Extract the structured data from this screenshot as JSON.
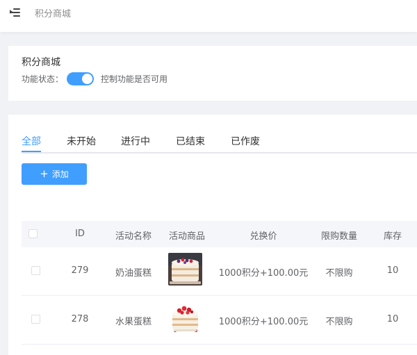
{
  "header": {
    "menu_icon": "hamburger-fold-icon",
    "breadcrumb": "积分商城"
  },
  "settings": {
    "title": "积分商城",
    "status_label": "功能状态：",
    "switch_on": true,
    "switch_description": "控制功能是否可用"
  },
  "tabs": [
    {
      "label": "全部",
      "active": true
    },
    {
      "label": "未开始",
      "active": false
    },
    {
      "label": "进行中",
      "active": false
    },
    {
      "label": "已结束",
      "active": false
    },
    {
      "label": "已作废",
      "active": false
    }
  ],
  "add_button": {
    "label": "添加",
    "icon": "plus-icon"
  },
  "table": {
    "columns": [
      "ID",
      "活动名称",
      "活动商品",
      "兑换价",
      "限购数量",
      "库存"
    ],
    "rows": [
      {
        "id": "279",
        "name": "奶油蛋糕",
        "image": "cream-cake-image",
        "price": "1000积分+100.00元",
        "limit": "不限购",
        "stock": "10"
      },
      {
        "id": "278",
        "name": "水果蛋糕",
        "image": "fruit-cake-image",
        "price": "1000积分+100.00元",
        "limit": "不限购",
        "stock": "10"
      }
    ]
  },
  "colors": {
    "accent": "#409eff",
    "header_bg": "#f5f6fa",
    "page_bg": "#f0f2f5"
  }
}
